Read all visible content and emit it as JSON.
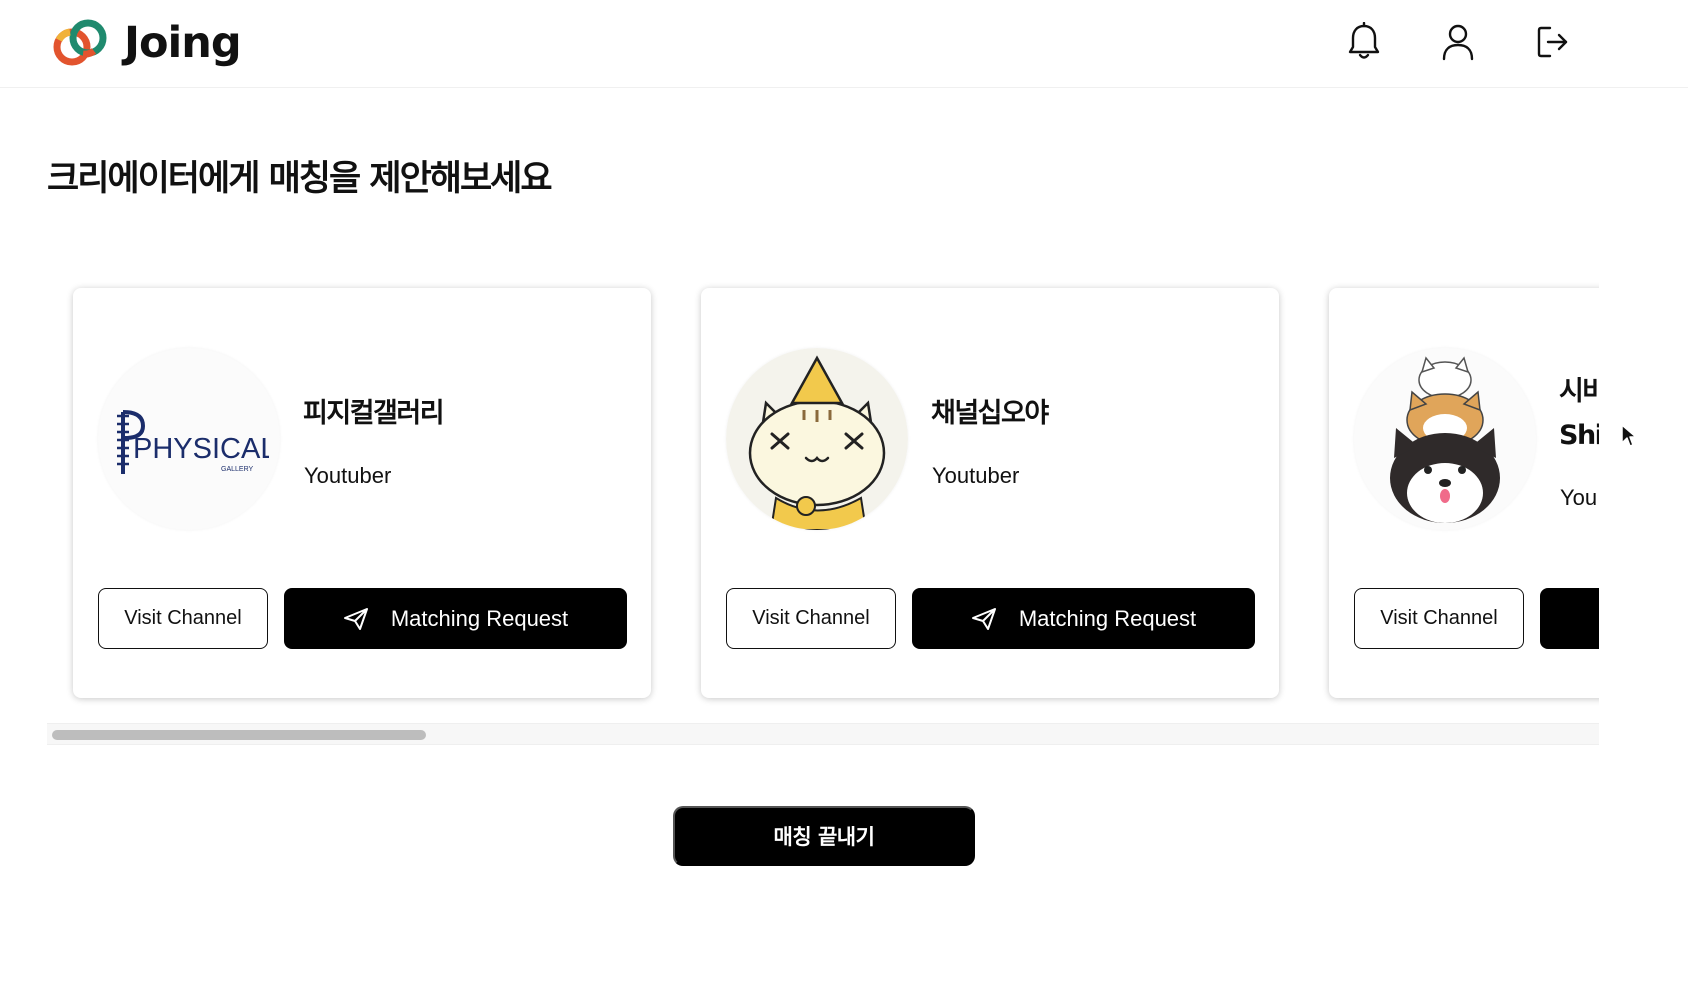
{
  "app": {
    "name": "Joing"
  },
  "header": {
    "icons": [
      "bell-icon",
      "user-icon",
      "logout-icon"
    ]
  },
  "page": {
    "title": "크리에이터에게 매칭을 제안해보세요"
  },
  "creators": [
    {
      "name": "피지컬갤러리",
      "role": "Youtuber",
      "avatar_text": "PHYSICAL",
      "avatar_subtext": "GALLERY",
      "visit_label": "Visit Channel",
      "match_label": "Matching Request"
    },
    {
      "name": "채널십오야",
      "role": "Youtuber",
      "visit_label": "Visit Channel",
      "match_label": "Matching Request"
    },
    {
      "name_lines": [
        "시바",
        "Shi"
      ],
      "role": "You",
      "visit_label": "Visit Channel",
      "match_label": ""
    }
  ],
  "finish_button": {
    "label": "매칭 끝내기"
  },
  "colors": {
    "primary": "#000000",
    "background": "#ffffff",
    "scroll_thumb": "#bdbdbd"
  }
}
